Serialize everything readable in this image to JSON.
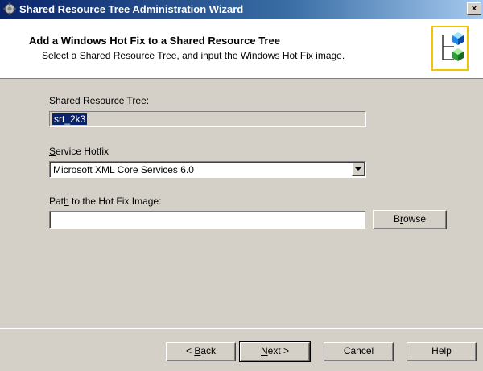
{
  "window": {
    "title": "Shared Resource Tree Administration Wizard",
    "close_label": "×"
  },
  "header": {
    "title": "Add a Windows Hot Fix to a Shared Resource Tree",
    "subtitle": "Select a Shared Resource Tree, and input the Windows Hot Fix image.",
    "icon": "shared-resource-tree-icon"
  },
  "form": {
    "srt": {
      "label_first": "S",
      "label_rest": "hared Resource Tree:",
      "value": "srt_2k3"
    },
    "hotfix": {
      "label_first": "S",
      "label_rest": "ervice Hotfix",
      "selected": "Microsoft XML Core Services 6.0"
    },
    "path": {
      "label_pre": "Pat",
      "label_accel": "h",
      "label_post": " to the Hot Fix Image:",
      "value": ""
    },
    "browse": {
      "pre": "B",
      "accel": "r",
      "post": "owse"
    }
  },
  "buttons": {
    "back": {
      "pre": "< ",
      "accel": "B",
      "post": "ack"
    },
    "next": {
      "accel": "N",
      "post": "ext >"
    },
    "cancel": "Cancel",
    "help": "Help"
  },
  "colors": {
    "title_bar": "#0a246a",
    "dialog_bg": "#d4d0c8",
    "icon_frame": "#f2c500"
  }
}
